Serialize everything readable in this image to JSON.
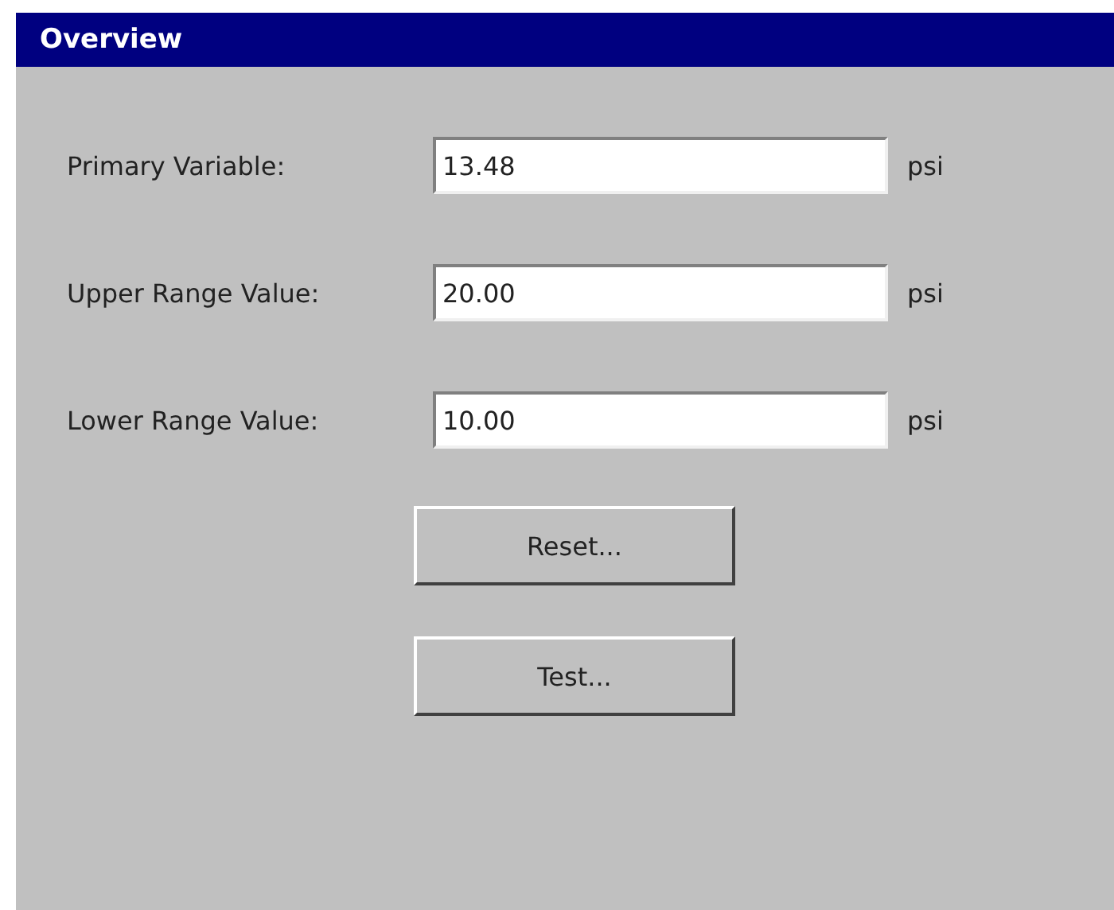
{
  "window": {
    "title": "Overview"
  },
  "fields": [
    {
      "label": "Primary Variable:",
      "value": "13.48",
      "unit": "psi"
    },
    {
      "label": "Upper Range Value:",
      "value": "20.00",
      "unit": "psi"
    },
    {
      "label": "Lower Range Value:",
      "value": "10.00",
      "unit": "psi"
    }
  ],
  "buttons": [
    "Reset...",
    "Test..."
  ]
}
